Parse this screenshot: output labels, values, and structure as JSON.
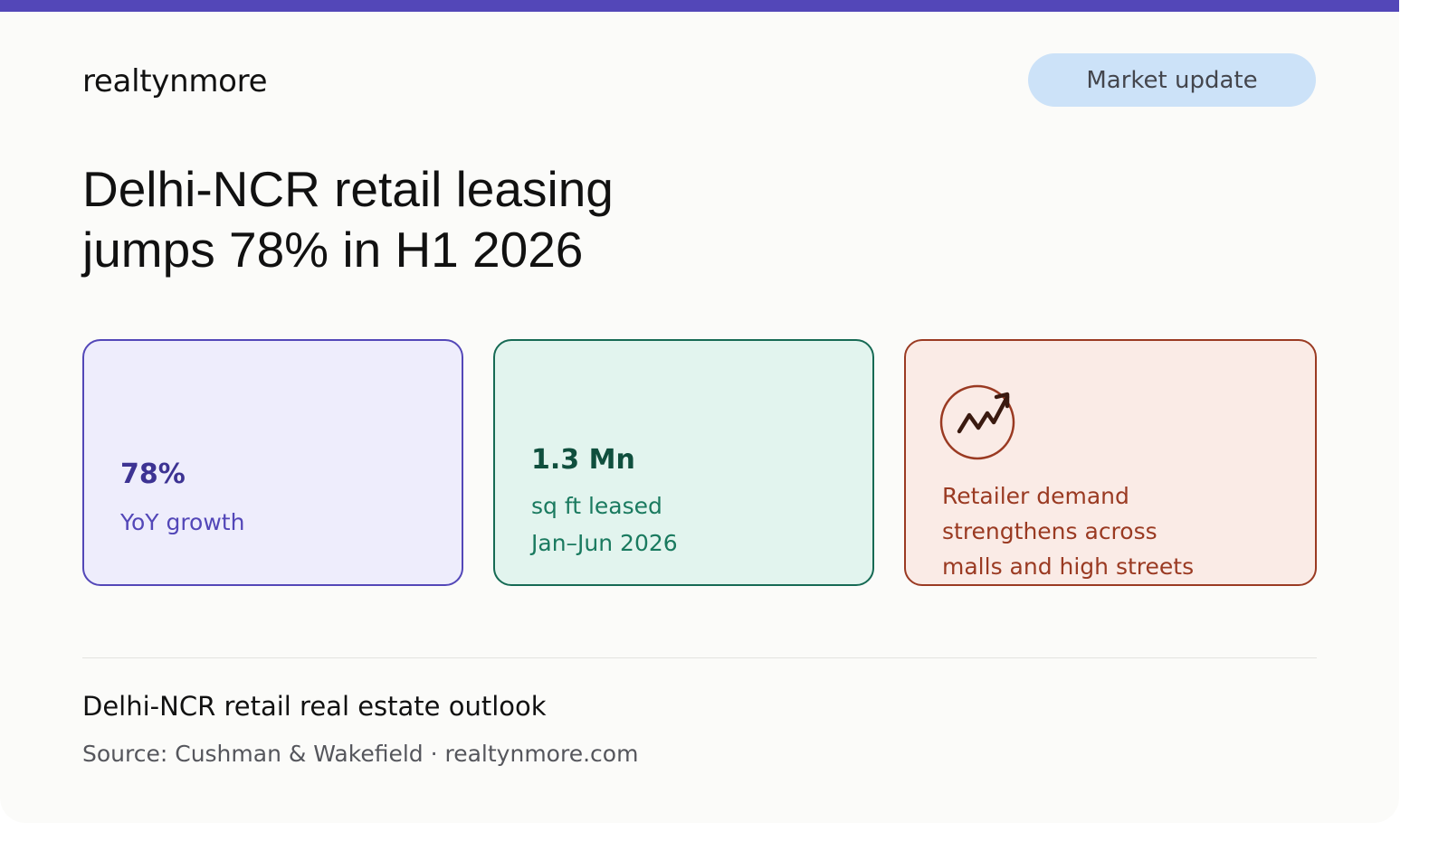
{
  "brand": {
    "name": "realtynmore"
  },
  "badge": {
    "label": "Market update"
  },
  "headline": {
    "line1": "Delhi-NCR retail leasing",
    "line2": "jumps 78% in H1 2026"
  },
  "stats": [
    {
      "value": "78%",
      "label": "YoY growth"
    },
    {
      "value": "1.3 Mn",
      "label_line1": "sq ft leased",
      "label_line2": "Jan–Jun 2026"
    },
    {
      "icon": "trend-up-icon",
      "text_line1": "Retailer demand",
      "text_line2": "strengthens across",
      "text_line3": "malls and high streets"
    }
  ],
  "footer": {
    "title": "Delhi-NCR retail real estate outlook",
    "source": "Source: Cushman & Wakefield · realtynmore.com"
  },
  "colors": {
    "accent": "#5347b8",
    "green": "#166a54",
    "rust": "#9a3a22",
    "pill": "#cce2f8"
  }
}
